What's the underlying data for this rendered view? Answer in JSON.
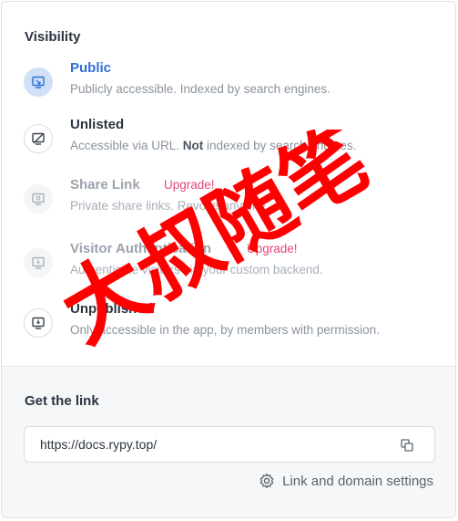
{
  "visibility": {
    "heading": "Visibility",
    "options": [
      {
        "title": "Public",
        "desc": "Publicly accessible. Indexed by search engines.",
        "state": "selected"
      },
      {
        "title": "Unlisted",
        "desc_pre": "Accessible via URL. ",
        "desc_bold": "Not",
        "desc_post": " indexed by search engines.",
        "state": "normal"
      },
      {
        "title": "Share Link",
        "upgrade": "Upgrade!",
        "desc": "Private share links. Revoke anytime.",
        "state": "disabled"
      },
      {
        "title": "Visitor Authentication",
        "upgrade": "Upgrade!",
        "desc": "Authenticate visitors via your custom backend.",
        "state": "disabled"
      },
      {
        "title": "Unpublished",
        "desc": "Only accessible in the app, by members with permission.",
        "state": "normal"
      }
    ]
  },
  "link": {
    "heading": "Get the link",
    "url": "https://docs.rypy.top/",
    "settings_label": "Link and domain settings"
  },
  "watermark": {
    "text": "大叔随笔",
    "color": "#ff0000"
  },
  "colors": {
    "accent": "#2f6fd6",
    "upgrade": "#e2477a"
  }
}
